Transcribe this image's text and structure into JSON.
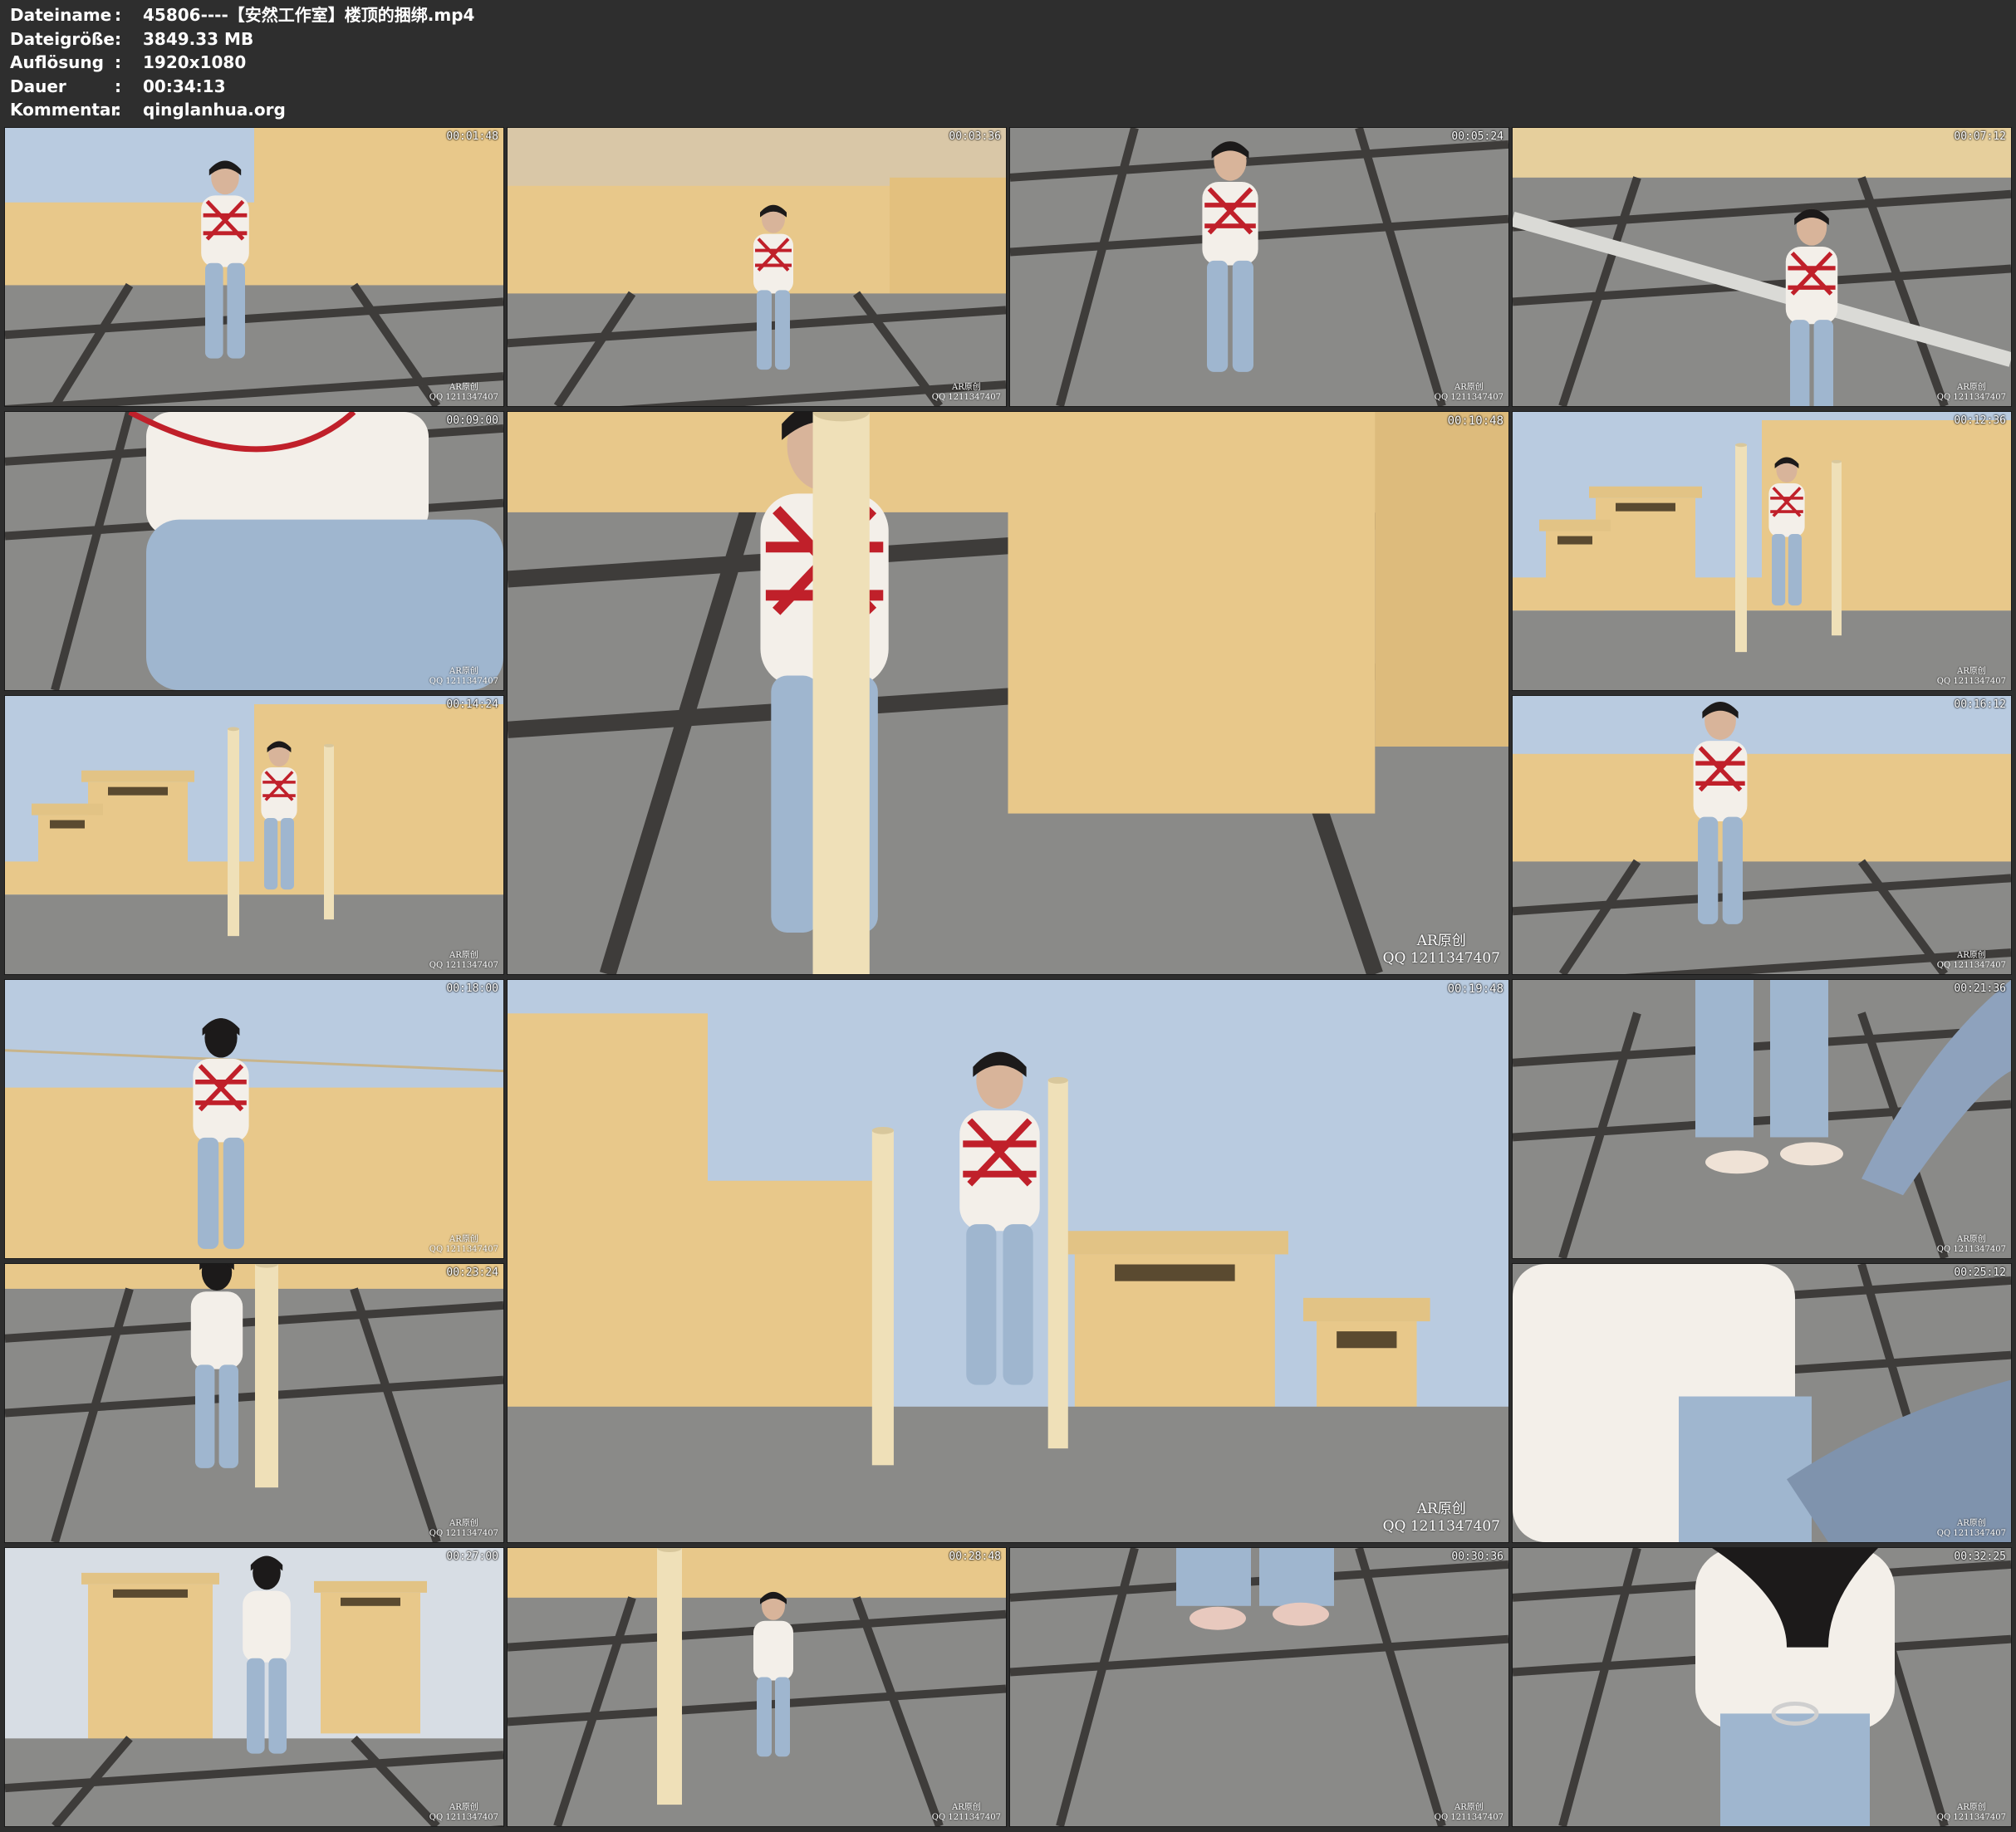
{
  "file_info": [
    {
      "key": "Dateiname",
      "sep": ":",
      "value": "45806----【安然工作室】楼顶的捆绑.mp4"
    },
    {
      "key": "Dateigröße",
      "sep": ":",
      "value": "3849.33 MB"
    },
    {
      "key": "Auflösung",
      "sep": ":",
      "value": "1920x1080"
    },
    {
      "key": "Dauer",
      "sep": ":",
      "value": "00:34:13"
    },
    {
      "key": "Kommentar",
      "sep": ":",
      "value": "qinglanhua.org"
    }
  ],
  "watermark": {
    "line1": "AR原创",
    "line2": "QQ 1211347407"
  },
  "thumbnails": [
    {
      "timestamp": "00:01:48",
      "scene": "wall-standing"
    },
    {
      "timestamp": "00:03:36",
      "scene": "wall-crouch"
    },
    {
      "timestamp": "00:05:24",
      "scene": "floor-sitting"
    },
    {
      "timestamp": "00:07:12",
      "scene": "pipe-sitting"
    },
    {
      "timestamp": "00:09:00",
      "scene": "torso-closeup"
    },
    {
      "timestamp": "00:10:48",
      "scene": "pole-back"
    },
    {
      "timestamp": "00:12:36",
      "scene": "pole-sky"
    },
    {
      "timestamp": "00:14:24",
      "scene": "pole-sky"
    },
    {
      "timestamp": "00:16:12",
      "scene": "standing-front"
    },
    {
      "timestamp": "00:18:00",
      "scene": "back-view"
    },
    {
      "timestamp": "00:19:48",
      "scene": "pole-sky-wide"
    },
    {
      "timestamp": "00:21:36",
      "scene": "feet-hand"
    },
    {
      "timestamp": "00:23:24",
      "scene": "pole-ground"
    },
    {
      "timestamp": "00:25:12",
      "scene": "hands-closeup"
    },
    {
      "timestamp": "00:27:00",
      "scene": "chimney-walk"
    },
    {
      "timestamp": "00:28:48",
      "scene": "pole-crouch"
    },
    {
      "timestamp": "00:30:36",
      "scene": "feet-floor"
    },
    {
      "timestamp": "00:32:25",
      "scene": "cuffs-back"
    }
  ],
  "colors": {
    "background": "#2e2e2e",
    "text": "#ffffff",
    "rope": "#c0202a",
    "wall": "#e8c88a",
    "floor": "#8a8a88",
    "sky": "#b9cbe0",
    "jeans": "#9fb6cf",
    "shirt": "#f3efe9"
  }
}
